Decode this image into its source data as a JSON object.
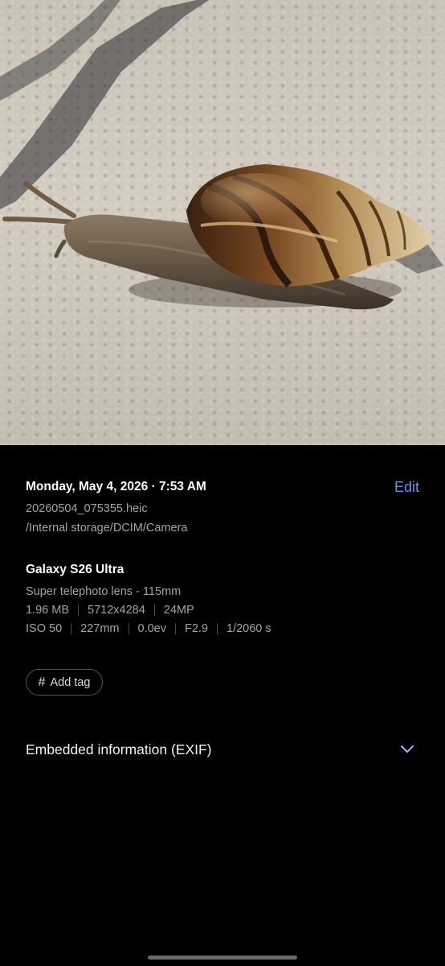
{
  "photo": {
    "subject": "snail on pavement"
  },
  "details": {
    "date_time": "Monday, May 4, 2026 · 7:53 AM",
    "edit_label": "Edit",
    "filename": "20260504_075355.heic",
    "path": "/Internal storage/DCIM/Camera"
  },
  "camera": {
    "device": "Galaxy S26 Ultra",
    "lens": "Super telephoto lens - 115mm",
    "file_size": "1.96 MB",
    "resolution": "5712x4284",
    "megapixels": "24MP",
    "iso": "ISO 50",
    "focal_length": "227mm",
    "exposure_value": "0.0ev",
    "aperture": "F2.9",
    "shutter_speed": "1/2060 s"
  },
  "tags": {
    "add_tag_label": "Add tag",
    "icon": "hash-icon"
  },
  "exif": {
    "label": "Embedded information (EXIF)",
    "icon": "chevron-down-icon"
  },
  "colors": {
    "accent": "#6f8ff0",
    "chevron": "#b9a6f2",
    "background": "#000000",
    "secondary_text": "#a3a3a3"
  }
}
